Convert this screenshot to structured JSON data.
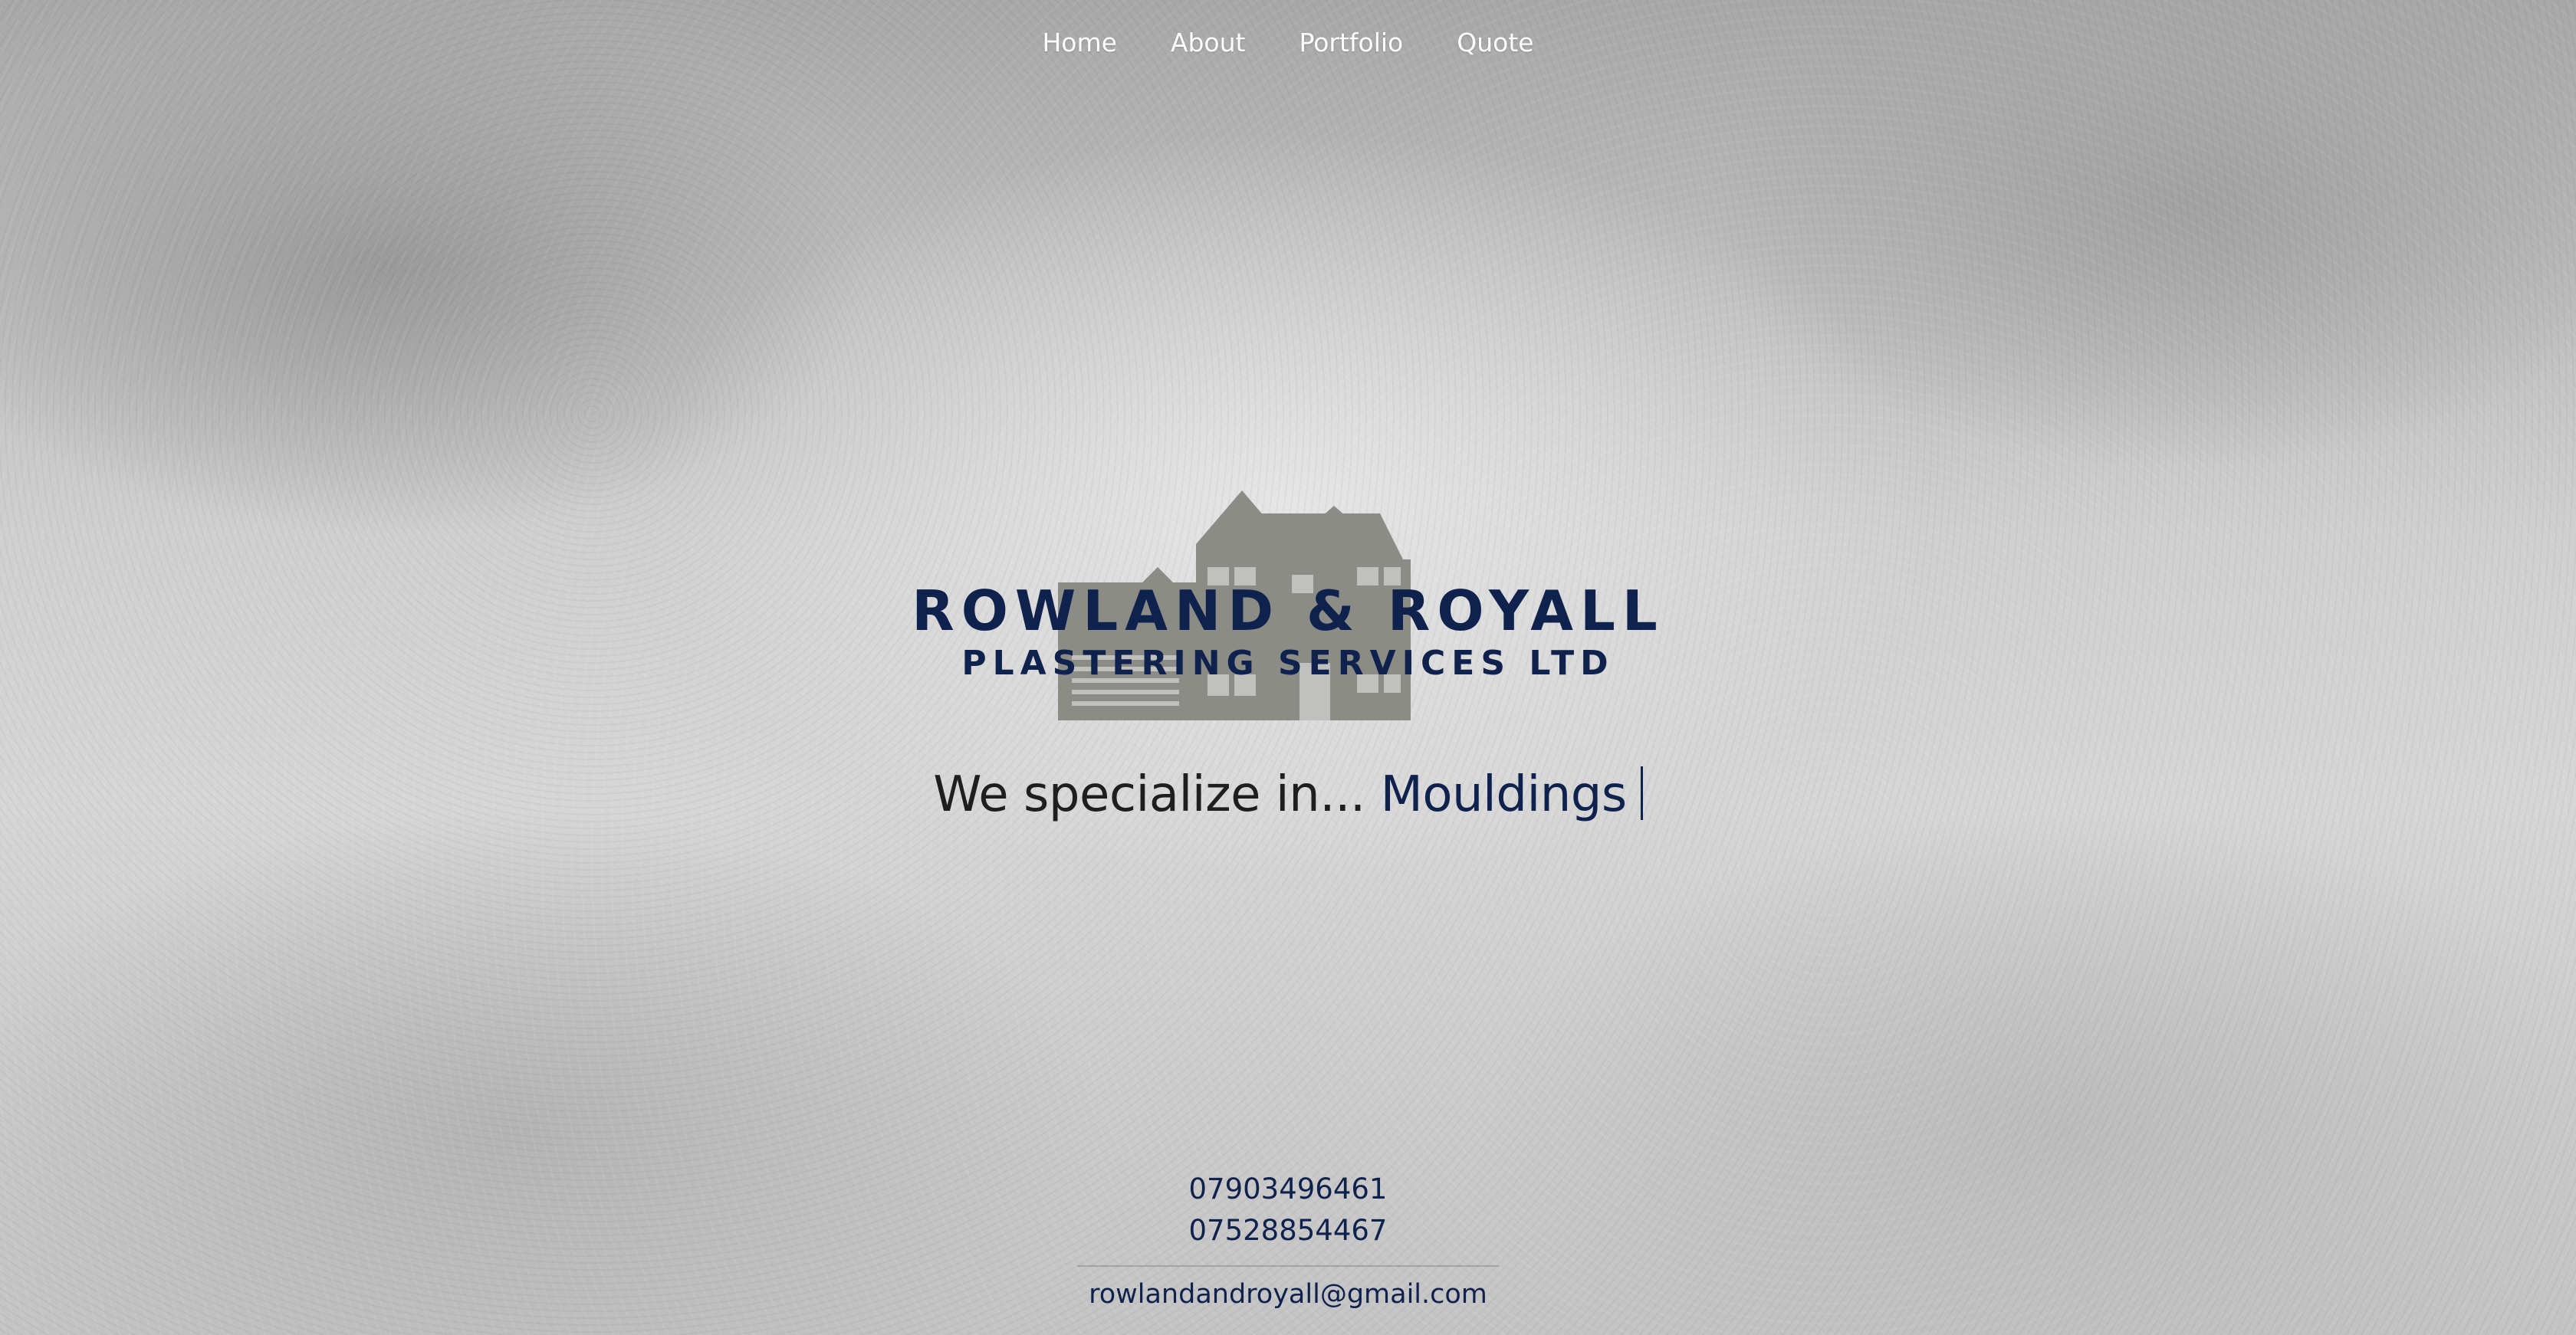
{
  "nav": {
    "items": [
      {
        "label": "Home"
      },
      {
        "label": "About"
      },
      {
        "label": "Portfolio"
      },
      {
        "label": "Quote"
      }
    ]
  },
  "logo": {
    "line1": "ROWLAND & ROYALL",
    "line2": "PLASTERING SERVICES LTD",
    "icon": "house-icon"
  },
  "tagline": {
    "prefix": "We specialize in...",
    "highlight": "Mouldings"
  },
  "contact": {
    "phones": [
      "07903496461",
      "07528854467"
    ],
    "email": "rowlandandroyall@gmail.com"
  },
  "colors": {
    "brand_navy": "#0f214d",
    "house_gray": "#8c8c86",
    "nav_text": "#ffffff"
  }
}
